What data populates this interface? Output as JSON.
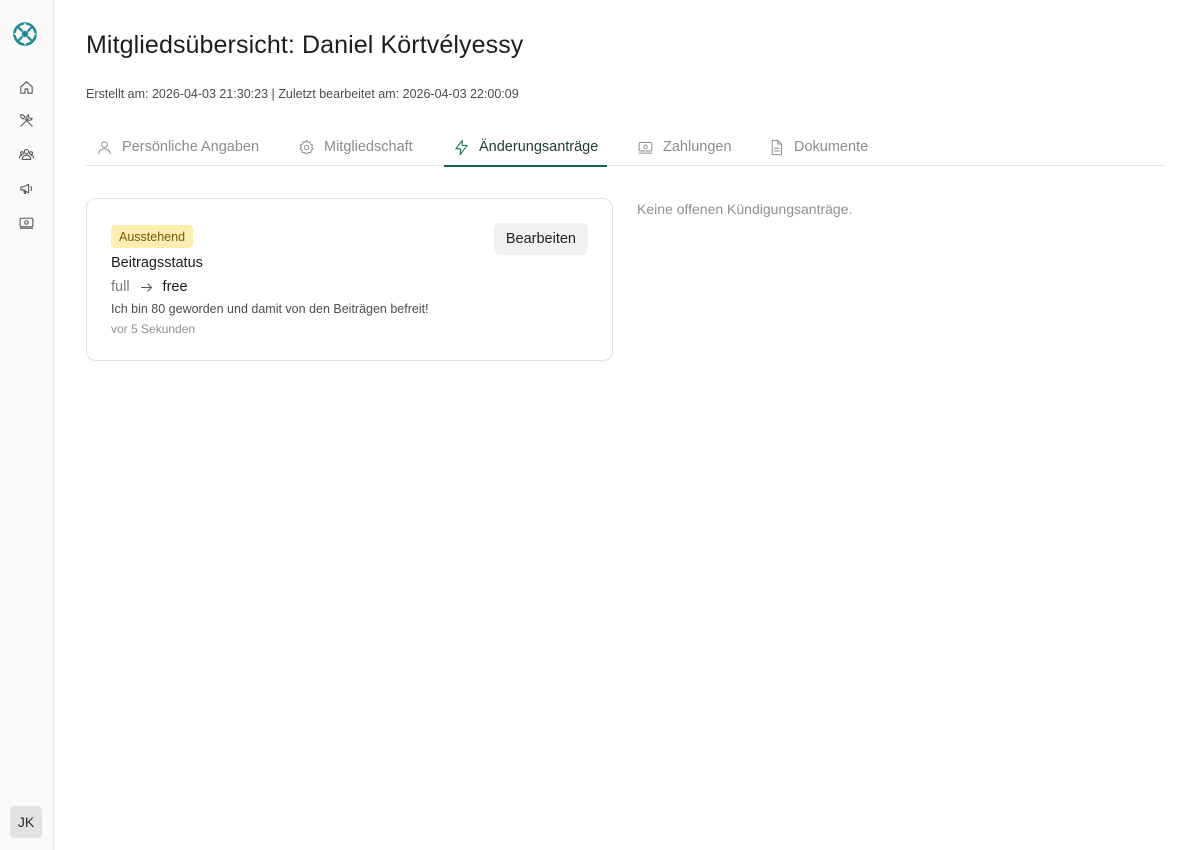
{
  "sidebar": {
    "items": [
      {
        "icon": "home-icon"
      },
      {
        "icon": "tools-icon"
      },
      {
        "icon": "users-icon"
      },
      {
        "icon": "megaphone-icon"
      },
      {
        "icon": "cash-icon"
      }
    ],
    "avatar_initials": "JK"
  },
  "header": {
    "title": "Mitgliedsübersicht: Daniel Körtvélyessy",
    "meta": "Erstellt am: 2026-04-03 21:30:23 | Zuletzt bearbeitet am: 2026-04-03 22:00:09"
  },
  "tabs": [
    {
      "label": "Persönliche Angaben",
      "icon": "user-icon",
      "active": false
    },
    {
      "label": "Mitgliedschaft",
      "icon": "gear-icon",
      "active": false
    },
    {
      "label": "Änderungsanträge",
      "icon": "lightning-icon",
      "active": true
    },
    {
      "label": "Zahlungen",
      "icon": "cash-icon",
      "active": false
    },
    {
      "label": "Dokumente",
      "icon": "document-icon",
      "active": false
    }
  ],
  "change_request": {
    "status": "Ausstehend",
    "edit_label": "Bearbeiten",
    "field": "Beitragsstatus",
    "old_value": "full",
    "new_value": "free",
    "reason": "Ich bin 80 geworden und damit von den Beiträgen befreit!",
    "time_ago": "vor 5 Sekunden"
  },
  "cancellation_note": "Keine offenen Kündigungsanträge.",
  "colors": {
    "accent": "#16614f",
    "badge_bg": "#fbeeb0",
    "badge_text": "#7a5b09",
    "logo": "#1f8a93"
  }
}
